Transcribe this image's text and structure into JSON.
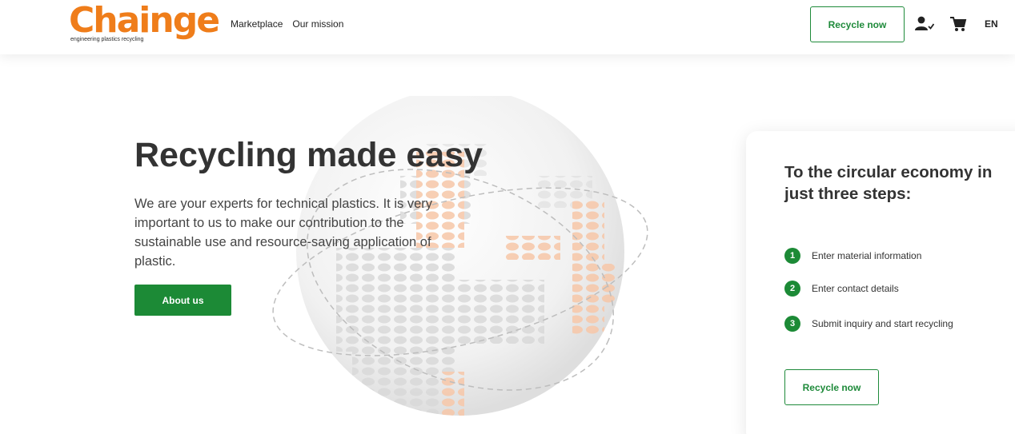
{
  "header": {
    "logo": {
      "word": "Chainge",
      "tagline": "engineering plastics recycling"
    },
    "nav": [
      {
        "label": "Marketplace"
      },
      {
        "label": "Our mission"
      }
    ],
    "recycle_label": "Recycle now",
    "language": "EN",
    "icons": {
      "account": "user-check-icon",
      "cart": "cart-icon"
    }
  },
  "hero": {
    "title": "Recycling made easy",
    "text": "We are your experts for technical plastics. It is very important to us to make our contribution to the sustainable use and resource-saving application of plastic.",
    "button_label": "About us"
  },
  "card": {
    "title": "To the circular economy in just three steps:",
    "steps": [
      {
        "number": "1",
        "label": "Enter material information"
      },
      {
        "number": "2",
        "label": "Enter contact details"
      },
      {
        "number": "3",
        "label": "Submit inquiry and start recycling"
      }
    ],
    "button_label": "Recycle now"
  },
  "colors": {
    "brand_orange": "#ef7d1a",
    "accent_green": "#1c8a36"
  }
}
